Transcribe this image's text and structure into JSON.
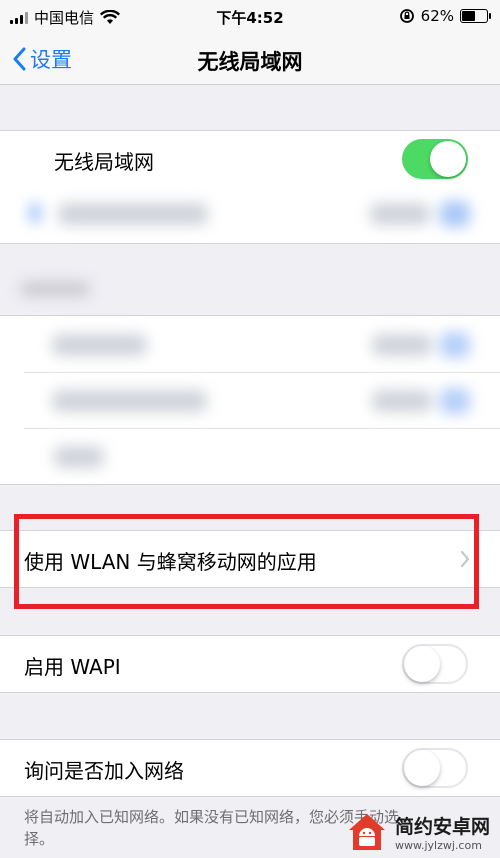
{
  "status_bar": {
    "carrier": "中国电信",
    "time": "下午4:52",
    "battery_percent": "62%",
    "battery_level": 0.62
  },
  "nav": {
    "back_label": "设置",
    "title": "无线局域网"
  },
  "wifi": {
    "label": "无线局域网",
    "enabled": true
  },
  "apps_row": {
    "label": "使用 WLAN 与蜂窝移动网的应用"
  },
  "wapi_row": {
    "label": "启用 WAPI",
    "enabled": false
  },
  "ask_join_row": {
    "label": "询问是否加入网络",
    "enabled": false
  },
  "footnote": "将自动加入已知网络。如果没有已知网络，您必须手动选择。",
  "watermark": {
    "name": "简约安卓网",
    "url": "www.jylzwj.com"
  },
  "colors": {
    "accent": "#1a7cf5",
    "toggle_on": "#4cd964",
    "highlight": "#e8202a"
  }
}
